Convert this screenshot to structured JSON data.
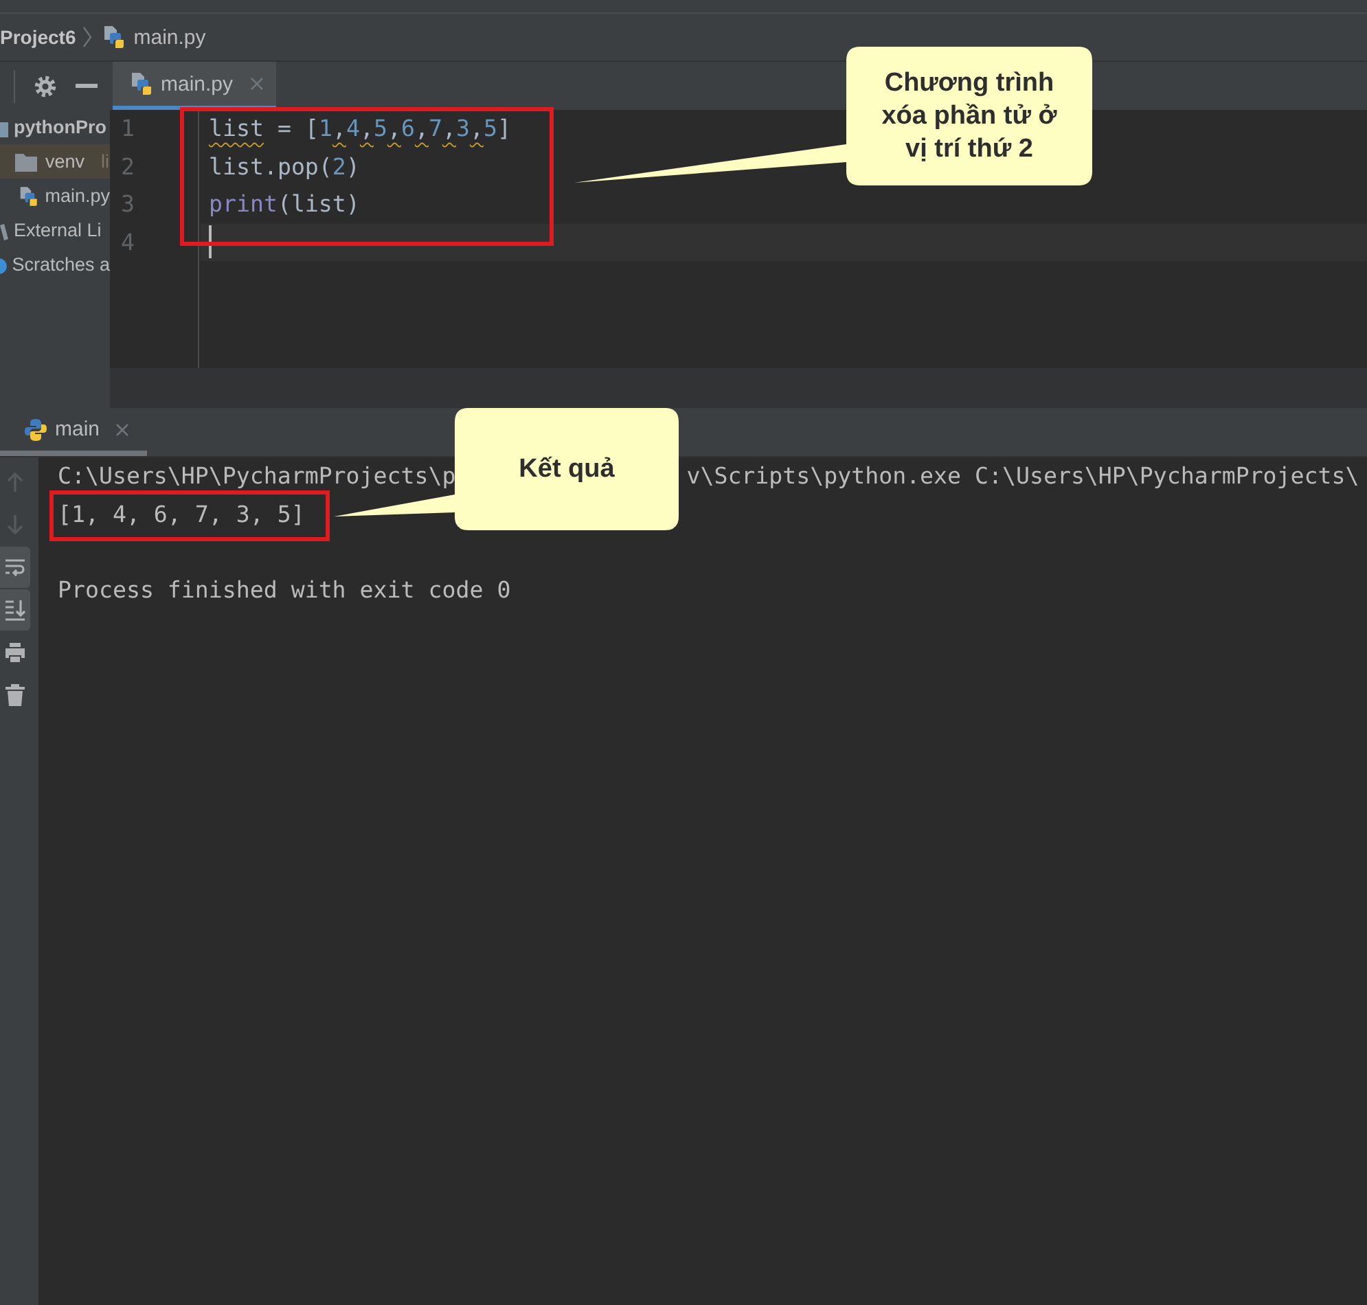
{
  "breadcrumbs": [
    {
      "kind": "project",
      "label": "Project6"
    },
    {
      "kind": "file",
      "label": "main.py"
    }
  ],
  "project_panel": {
    "items": [
      {
        "kind": "project",
        "label": "pythonPro",
        "selected": false,
        "children": [
          {
            "kind": "folder",
            "label": "venv",
            "note": "li",
            "selected": true
          },
          {
            "kind": "python-file",
            "label": "main.py",
            "selected": false
          }
        ]
      },
      {
        "kind": "libraries",
        "label": "External Li",
        "selected": false
      },
      {
        "kind": "scratches",
        "label": "Scratches a",
        "selected": false
      }
    ]
  },
  "editor": {
    "tabs": [
      {
        "label": "main.py",
        "selected": true
      }
    ],
    "lines": [
      {
        "number": "1",
        "current": false,
        "tokens": [
          {
            "text": "list",
            "kind": "name",
            "warning": true
          },
          {
            "text": " = [",
            "kind": "plain",
            "warning": false
          },
          {
            "text": "1,4,5,6,7,3,5",
            "kind": "sequence",
            "warning": true
          },
          {
            "text": "]",
            "kind": "plain",
            "warning": false
          }
        ]
      },
      {
        "number": "2",
        "current": false,
        "tokens": [
          {
            "text": "list.pop(",
            "kind": "plain",
            "warning": false
          },
          {
            "text": "2",
            "kind": "number",
            "warning": false
          },
          {
            "text": ")",
            "kind": "plain",
            "warning": false
          }
        ]
      },
      {
        "number": "3",
        "current": false,
        "tokens": [
          {
            "text": "print",
            "kind": "builtin",
            "warning": false
          },
          {
            "text": "(list)",
            "kind": "plain",
            "warning": false
          }
        ]
      },
      {
        "number": "4",
        "current": true
      }
    ]
  },
  "run_panel": {
    "tabs": [
      {
        "label": "main",
        "selected": true
      }
    ],
    "toolbar": [
      {
        "kind": "up",
        "disabled": true,
        "on": false
      },
      {
        "kind": "down",
        "disabled": true,
        "on": false
      },
      {
        "kind": "wrap",
        "disabled": false,
        "on": true
      },
      {
        "kind": "scroll-end",
        "disabled": false,
        "on": true
      },
      {
        "kind": "print",
        "disabled": false,
        "on": false
      },
      {
        "kind": "delete",
        "disabled": false,
        "on": false
      }
    ],
    "console": [
      {
        "kind": "command",
        "segments": [
          "C:\\Users\\HP\\PycharmProjects\\p",
          "v\\Scripts\\python.exe C:\\Users\\HP\\PycharmProjects\\"
        ]
      },
      {
        "kind": "output",
        "segments": [
          "[1, 4, 6, 7, 3, 5]"
        ]
      },
      {
        "kind": "exit",
        "segments": [
          "Process finished with exit code 0"
        ]
      }
    ]
  },
  "annotations": [
    {
      "kind": "code",
      "text": "Chương trình xóa phần tử ở vị trí thứ 2"
    },
    {
      "kind": "output",
      "text": "Kết quả"
    }
  ]
}
